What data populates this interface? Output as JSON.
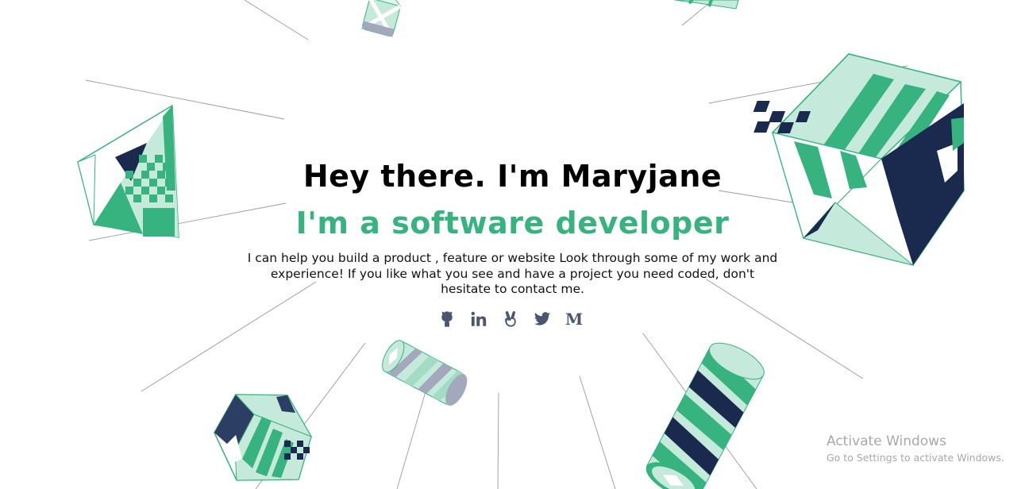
{
  "hero": {
    "title": "Hey there. I'm Maryjane",
    "subtitle": "I'm a software developer",
    "description": "I can help you build a product , feature or website Look through some of my work and experience! If you like what you see and have a project you need coded, don't hesitate to contact me."
  },
  "social": {
    "links": [
      {
        "icon": "github-icon"
      },
      {
        "icon": "linkedin-icon"
      },
      {
        "icon": "angellist-icon"
      },
      {
        "icon": "twitter-icon"
      },
      {
        "icon": "medium-icon",
        "glyph": "M"
      }
    ]
  },
  "watermark": {
    "title": "Activate Windows",
    "subtitle": "Go to Settings to activate Windows."
  },
  "colors": {
    "accent": "#36b37e",
    "navy": "#1a2a4f",
    "mint": "#c5e9da",
    "icon": "#4a5570",
    "line": "#9a9a9a"
  }
}
